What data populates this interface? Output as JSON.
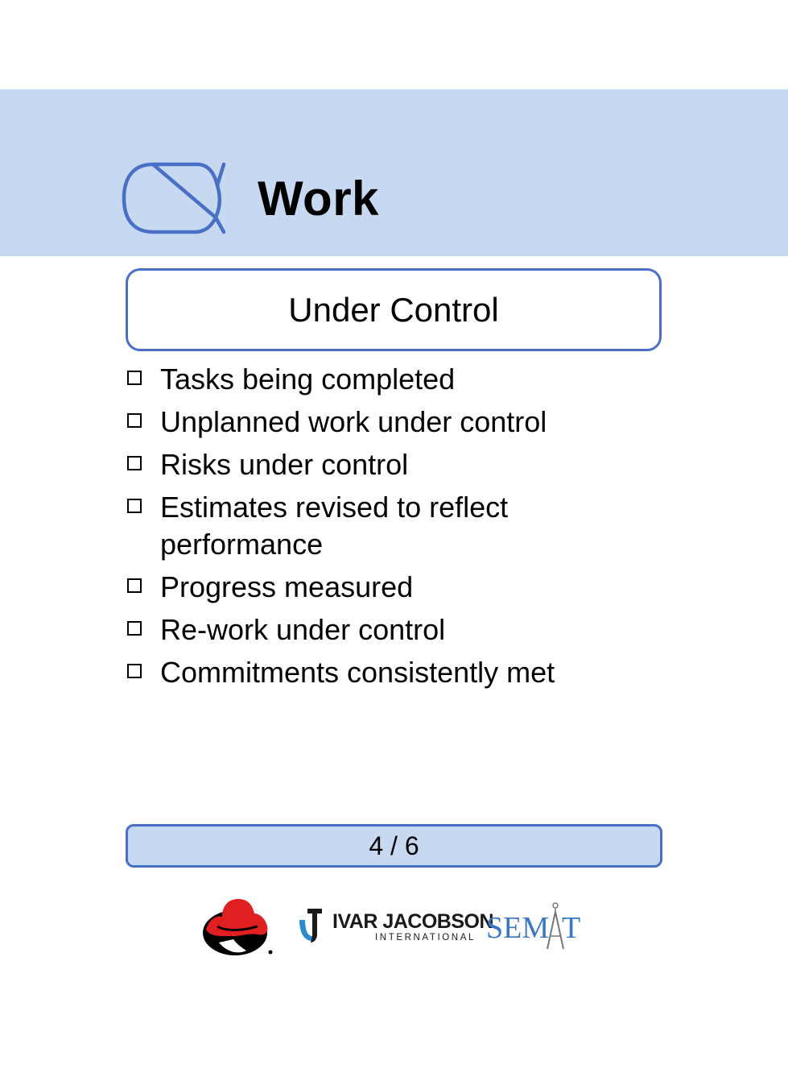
{
  "card": {
    "alpha_title": "Work",
    "state_name": "Under Control",
    "checklist": [
      "Tasks being completed",
      "Unplanned work under control",
      "Risks under control",
      "Estimates revised to reflect performance",
      "Progress measured",
      "Re-work under control",
      "Commitments consistently met"
    ],
    "page_counter": "4 / 6"
  },
  "logos": {
    "redhat": "red-hat-logo",
    "ivar_jacobson": {
      "name": "IVAR JACOBSON",
      "sub": "INTERNATIONAL"
    },
    "semat": "SEMAT"
  },
  "colors": {
    "header_band": "#c6d9f1",
    "accent_border": "#4a6fc7",
    "semat_blue": "#3a78c2",
    "redhat_red": "#e02020"
  }
}
